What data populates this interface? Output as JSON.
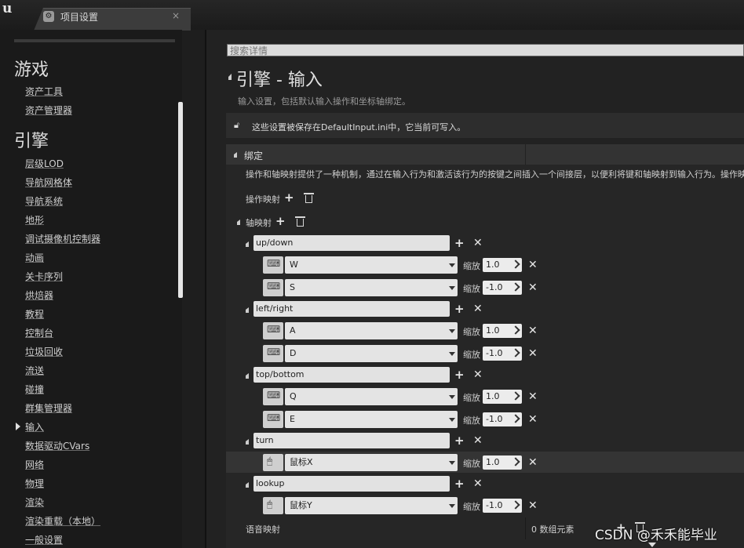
{
  "tab": {
    "title": "项目设置",
    "close": "×"
  },
  "logo": {
    "glyph": "u"
  },
  "sidebar": {
    "categories": {
      "game": "游戏",
      "engine": "引擎"
    },
    "items": [
      "资产工具",
      "资产管理器",
      "层级LOD",
      "导航网格体",
      "导航系统",
      "地形",
      "调试摄像机控制器",
      "动画",
      "关卡序列",
      "烘焙器",
      "教程",
      "控制台",
      "垃圾回收",
      "流送",
      "碰撞",
      "群集管理器",
      "输入",
      "数据驱动CVars",
      "网络",
      "物理",
      "渲染",
      "渲染重载（本地）",
      "一般设置"
    ]
  },
  "search": {
    "placeholder": "搜索详情"
  },
  "page": {
    "title": "引擎 - 输入",
    "description": "输入设置，包括默认输入操作和坐标轴绑定。",
    "info": "这些设置被保存在DefaultInput.ini中，它当前可写入。"
  },
  "bindings": {
    "title": "绑定",
    "description": "操作和轴映射提供了一种机制，通过在输入行为和激活该行为的按键之间插入一个间接层，以便利将键和轴映射到输入行为。操作映射",
    "action_mappings_label": "操作映射",
    "axis_mappings_label": "轴映射",
    "scale_label": "缩放",
    "axes": [
      {
        "name": "up/down",
        "keys": [
          {
            "key": "W",
            "scale": "1.0",
            "icon": "keyboard-icon"
          },
          {
            "key": "S",
            "scale": "-1.0",
            "icon": "keyboard-icon"
          }
        ]
      },
      {
        "name": "left/right",
        "keys": [
          {
            "key": "A",
            "scale": "1.0",
            "icon": "keyboard-icon"
          },
          {
            "key": "D",
            "scale": "-1.0",
            "icon": "keyboard-icon"
          }
        ]
      },
      {
        "name": "top/bottom",
        "keys": [
          {
            "key": "Q",
            "scale": "1.0",
            "icon": "keyboard-icon"
          },
          {
            "key": "E",
            "scale": "-1.0",
            "icon": "keyboard-icon"
          }
        ]
      },
      {
        "name": "turn",
        "keys": [
          {
            "key": "鼠标X",
            "scale": "1.0",
            "icon": "mouse-icon"
          }
        ]
      },
      {
        "name": "lookup",
        "keys": [
          {
            "key": "鼠标Y",
            "scale": "-1.0",
            "icon": "mouse-icon"
          }
        ]
      }
    ],
    "speech_mappings_label": "语音映射",
    "speech_count": "0 数组元素"
  },
  "watermark": "CSDN @禾禾能毕业",
  "colors": {
    "background": "#1e1e1e",
    "panel": "#262626",
    "field": "#e2e2e2"
  }
}
